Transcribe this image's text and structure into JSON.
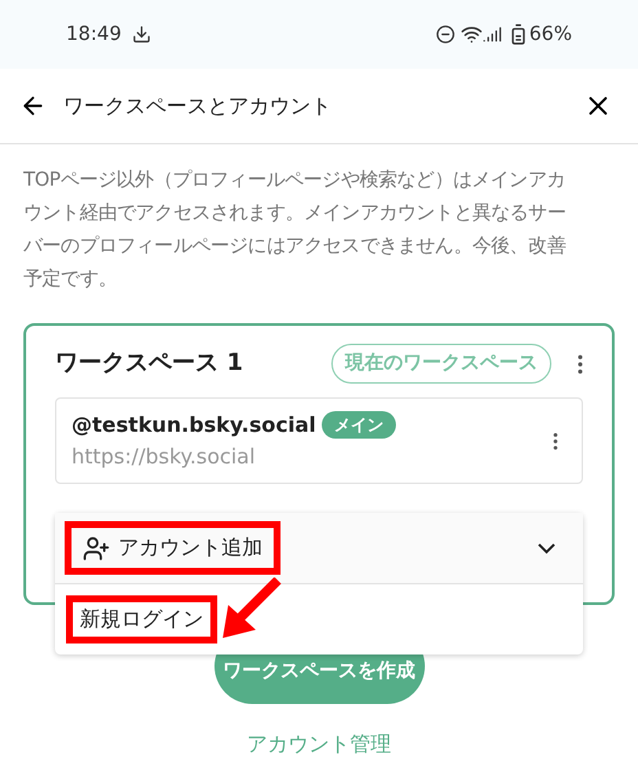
{
  "status_bar": {
    "time": "18:49",
    "battery": "66%"
  },
  "header": {
    "title": "ワークスペースとアカウント"
  },
  "notice": "TOPページ以外（プロフィールページや検索など）はメインアカウント経由でアクセスされます。メインアカウントと異なるサーバーのプロフィールページにはアクセスできません。今後、改善予定です。",
  "workspace": {
    "title": "ワークスペース 1",
    "current_badge": "現在のワークスペース",
    "accounts": [
      {
        "handle": "@testkun.bsky.social",
        "badge": "メイン",
        "server": "https://bsky.social"
      }
    ]
  },
  "menu": {
    "expanded": true,
    "items": [
      {
        "kind": "trigger",
        "label": "アカウント追加",
        "highlighted": true
      },
      {
        "kind": "option",
        "label": "新規ログイン",
        "highlighted": true
      }
    ]
  },
  "create_button": "ワークスペースを作成",
  "manage_link": "アカウント管理"
}
